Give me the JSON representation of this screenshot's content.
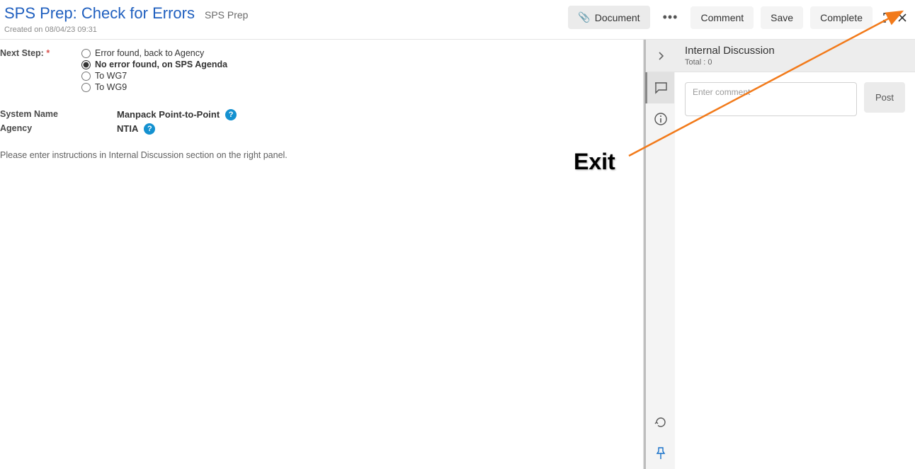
{
  "header": {
    "title": "SPS Prep: Check for Errors",
    "subtitle": "SPS Prep",
    "created_on": "Created on 08/04/23 09:31",
    "buttons": {
      "document": "Document",
      "comment": "Comment",
      "save": "Save",
      "complete": "Complete"
    }
  },
  "form": {
    "next_step_label": "Next Step:",
    "radios": [
      {
        "label": "Error found, back to Agency",
        "checked": false
      },
      {
        "label": "No error found, on SPS Agenda",
        "checked": true
      },
      {
        "label": "To WG7",
        "checked": false
      },
      {
        "label": "To WG9",
        "checked": false
      }
    ],
    "system_name_label": "System Name",
    "system_name_value": "Manpack Point-to-Point",
    "agency_label": "Agency",
    "agency_value": "NTIA",
    "instructions": "Please enter instructions in Internal Discussion section on the right panel."
  },
  "side": {
    "disc_title": "Internal Discussion",
    "disc_total": "Total : 0",
    "comment_placeholder": "Enter comment",
    "post_label": "Post"
  },
  "annotation": {
    "exit_label": "Exit"
  }
}
